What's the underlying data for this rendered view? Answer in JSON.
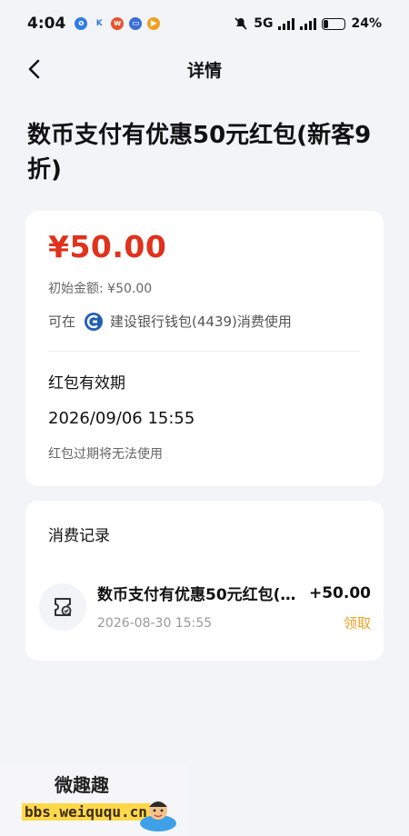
{
  "status": {
    "time": "4:04",
    "network": "5G",
    "battery": "24%",
    "app_icons": [
      "o-icon",
      "k-icon",
      "weibo-icon",
      "message-icon",
      "video-icon"
    ],
    "battery_level": 0.24
  },
  "nav": {
    "title": "详情"
  },
  "page_title": "数币支付有优惠50元红包(新客9折)",
  "coupon": {
    "amount": "¥50.00",
    "initial_label": "初始金额:",
    "initial_amount": "¥50.00",
    "usage_prefix": "可在",
    "usage_text": "建设银行钱包(4439)消费使用",
    "validity_label": "红包有效期",
    "validity_date": "2026/09/06 15:55",
    "expiry_note": "红包过期将无法使用"
  },
  "records": {
    "title": "消费记录",
    "items": [
      {
        "name": "数币支付有优惠50元红包(…",
        "amount": "+50.00",
        "time": "2026-08-30 15:55",
        "action": "领取"
      }
    ]
  },
  "watermark": {
    "title": "微趣趣",
    "url": "bbs.weiququ.cn"
  },
  "colors": {
    "amount_red": "#e0321c",
    "action_orange": "#f0a020",
    "background": "#f3f4f8"
  }
}
